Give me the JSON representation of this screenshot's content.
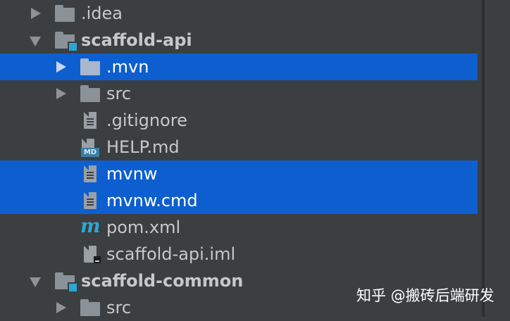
{
  "tree": {
    "items": [
      {
        "label": ".idea",
        "icon": "folder-icon",
        "expander": "expand-arrow-icon"
      },
      {
        "label": "scaffold-api",
        "icon": "module-folder-icon",
        "expander": "collapse-arrow-icon"
      },
      {
        "label": ".mvn",
        "icon": "folder-icon",
        "expander": "expand-arrow-icon",
        "selected": true
      },
      {
        "label": "src",
        "icon": "folder-icon",
        "expander": "expand-arrow-icon"
      },
      {
        "label": ".gitignore",
        "icon": "text-file-icon"
      },
      {
        "label": "HELP.md",
        "icon": "markdown-file-icon",
        "badge": "MD"
      },
      {
        "label": "mvnw",
        "icon": "text-file-icon",
        "selected": true
      },
      {
        "label": "mvnw.cmd",
        "icon": "text-file-icon",
        "selected": true
      },
      {
        "label": "pom.xml",
        "icon": "maven-icon",
        "glyph": "m"
      },
      {
        "label": "scaffold-api.iml",
        "icon": "iml-file-icon"
      },
      {
        "label": "scaffold-common",
        "icon": "module-folder-icon",
        "expander": "collapse-arrow-icon"
      },
      {
        "label": "src",
        "icon": "folder-icon",
        "expander": "expand-arrow-icon"
      }
    ]
  },
  "colors": {
    "background": "#3c3f41",
    "selection": "#0d5fd0",
    "module_accent": "#2aa6d6"
  },
  "watermark": {
    "text": "知乎 @搬砖后端研发"
  }
}
